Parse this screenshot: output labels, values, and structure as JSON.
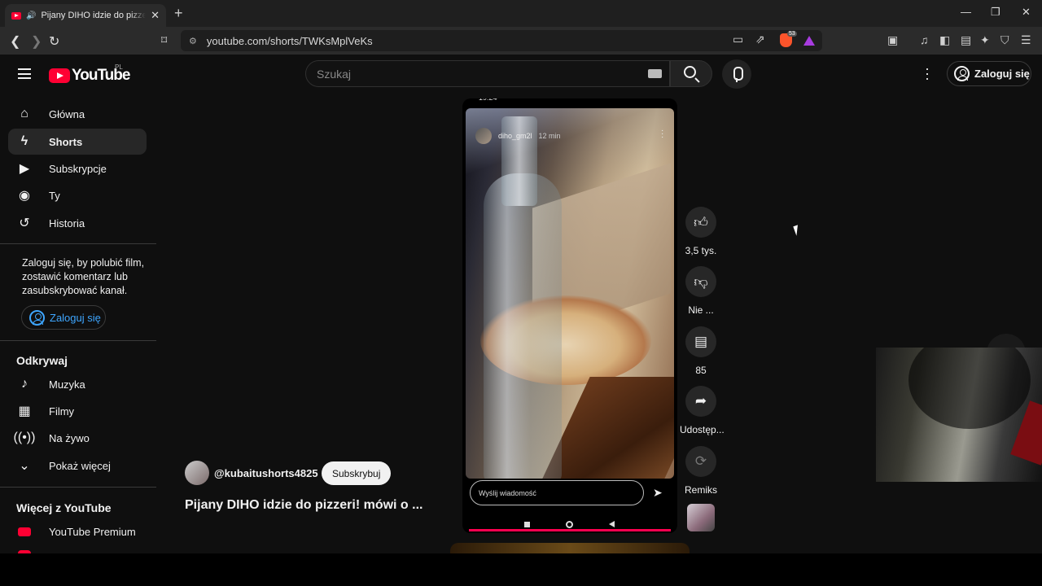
{
  "browser": {
    "tab_title": "Pijany DIHO idzie do pizzeri! mówi o",
    "url": "youtube.com/shorts/TWKsMplVeKs",
    "brave_badge": "53"
  },
  "header": {
    "logo_text": "YouTube",
    "region": "PL",
    "search_placeholder": "Szukaj",
    "signin_label": "Zaloguj się"
  },
  "sidebar": {
    "items": [
      {
        "label": "Główna",
        "icon": "home-icon"
      },
      {
        "label": "Shorts",
        "icon": "shorts-icon"
      },
      {
        "label": "Subskrypcje",
        "icon": "subscriptions-icon"
      },
      {
        "label": "Ty",
        "icon": "you-icon"
      },
      {
        "label": "Historia",
        "icon": "history-icon"
      }
    ],
    "promo_text": "Zaloguj się, by polubić film, zostawić komentarz lub zasubskrybować kanał.",
    "signin_label": "Zaloguj się",
    "explore_title": "Odkrywaj",
    "explore": [
      {
        "label": "Muzyka",
        "icon": "music-note-icon"
      },
      {
        "label": "Filmy",
        "icon": "film-icon"
      },
      {
        "label": "Na żywo",
        "icon": "live-icon"
      },
      {
        "label": "Pokaż więcej",
        "icon": "chevron-down-icon"
      }
    ],
    "more_title": "Więcej z YouTube",
    "more": [
      {
        "label": "YouTube Premium",
        "icon": "youtube-premium-icon"
      }
    ]
  },
  "short": {
    "story_user": "diho_gm2l",
    "story_time": "12 min",
    "reply_placeholder": "Wyślij wiadomość",
    "channel": "@kubaitushorts4825",
    "subscribe_label": "Subskrybuj",
    "title": "Pijany DIHO idzie do pizzeri! mówi o ...",
    "actions": {
      "like_count": "3,5 tys.",
      "dislike_label": "Nie ...",
      "comments_count": "85",
      "share_label": "Udostęp...",
      "remix_label": "Remiks"
    }
  },
  "colors": {
    "accent": "#3ea6ff",
    "brand_red": "#ff0033",
    "background": "#0f0f0f"
  }
}
